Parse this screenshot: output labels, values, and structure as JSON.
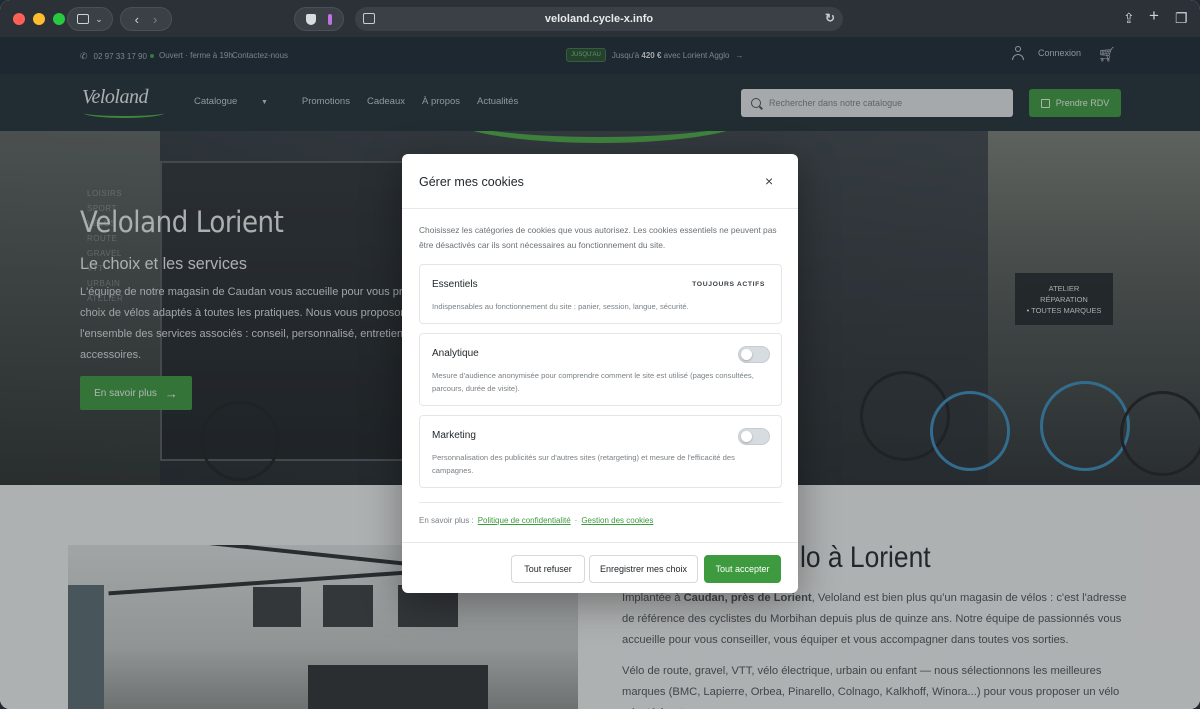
{
  "browser": {
    "url": "veloland.cycle-x.info"
  },
  "topbar": {
    "phone": "02 97 33 17 90",
    "hours": "Ouvert · ferme à 19h",
    "contact": "Contactez-nous",
    "promo_tag": "JUSQU'AU",
    "promo_prefix": "Jusqu'à",
    "promo_amount": "420 €",
    "promo_suffix": "avec Lorient Agglo",
    "promo_arrow": "→",
    "login": "Connexion"
  },
  "nav": {
    "logo": "Veloland",
    "items": [
      "Catalogue",
      "Promotions",
      "Cadeaux",
      "À propos",
      "Actualités"
    ],
    "search_placeholder": "Rechercher dans notre catalogue",
    "rdv_label": "Prendre RDV"
  },
  "hero": {
    "title": "Veloland Lorient",
    "subtitle": "Le choix et les services",
    "description_lines": [
      "L'équipe de notre magasin de Caudan vous accueille pour vous présenter",
      "choix de vélos adaptés à toutes les pratiques. Nous vous proposons",
      "l'ensemble des services associés : conseil, personnalisé, entretien, ré",
      "accessoires."
    ],
    "side_words": [
      "LOISIRS",
      "SPORT",
      "VÉLOS",
      "ROUTE",
      "GRAVEL",
      "VTT",
      "URBAIN",
      "ATELIER"
    ],
    "cta_label": "En savoir plus",
    "cta_arrow": "→",
    "sign_lines": [
      "ATELIER",
      "RÉPARATION",
      "• TOUTES MARQUES"
    ]
  },
  "lower": {
    "heading": "lo à Lorient",
    "p1_parts": [
      "Implantée à ",
      "Caudan, près de Lorient",
      ", Veloland est bien plus qu'un magasin de vélos : c'est l'adresse de référence des cyclistes du Morbihan depuis plus de quinze ans. Notre équipe de passionnés vous accueille pour vous conseiller, vous équiper et vous accompagner dans toutes vos sorties."
    ],
    "p2": "Vélo de route, gravel, VTT, vélo électrique, urbain ou enfant — nous sélectionnons les meilleures marques (BMC, Lapierre, Orbea, Pinarello, Colnago, Kalkhoff, Winora...) pour vous proposer un vélo adapté à votre"
  },
  "modal": {
    "title": "Gérer mes cookies",
    "close": "×",
    "intro": "Choisissez les catégories de cookies que vous autorisez. Les cookies essentiels ne peuvent pas être désactivés car ils sont nécessaires au fonctionnement du site.",
    "categories": [
      {
        "name": "Essentiels",
        "status": "TOUJOURS ACTIFS",
        "description": "Indispensables au fonctionnement du site : panier, session, langue, sécurité."
      },
      {
        "name": "Analytique",
        "enabled": false,
        "description": "Mesure d'audience anonymisée pour comprendre comment le site est utilisé (pages consultées, parcours, durée de visite)."
      },
      {
        "name": "Marketing",
        "enabled": false,
        "description": "Personnalisation des publicités sur d'autres sites (retargeting) et mesure de l'efficacité des campagnes."
      }
    ],
    "links_prefix": "En savoir plus :",
    "privacy_link": "Politique de confidentialité",
    "separator": "·",
    "cookies_link": "Gestion des cookies",
    "refuse_label": "Tout refuser",
    "save_label": "Enregistrer mes choix",
    "accept_label": "Tout accepter"
  }
}
